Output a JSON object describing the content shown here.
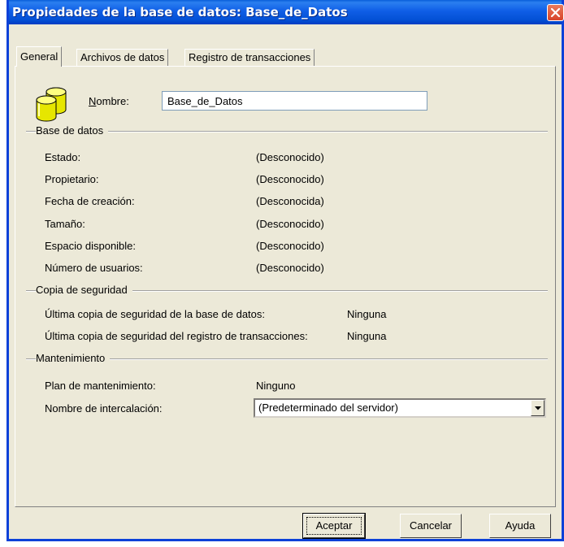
{
  "window": {
    "title": "Propiedades de la base de datos: Base_de_Datos"
  },
  "tabs": [
    {
      "label": "General"
    },
    {
      "label": "Archivos de datos"
    },
    {
      "label": "Registro de transacciones"
    }
  ],
  "name": {
    "label_prefix": "N",
    "label_rest": "ombre:",
    "value": "Base_de_Datos"
  },
  "database": {
    "section_title": "Base de datos",
    "rows": [
      {
        "label": "Estado:",
        "value": "(Desconocido)"
      },
      {
        "label": "Propietario:",
        "value": "(Desconocido)"
      },
      {
        "label": "Fecha de creación:",
        "value": "(Desconocida)"
      },
      {
        "label": "Tamaño:",
        "value": "(Desconocido)"
      },
      {
        "label": "Espacio disponible:",
        "value": "(Desconocido)"
      },
      {
        "label": "Número de usuarios:",
        "value": "(Desconocido)"
      }
    ]
  },
  "backup": {
    "section_title": "Copia de seguridad",
    "rows": [
      {
        "label": "Última copia de seguridad de la base de datos:",
        "value": "Ninguna"
      },
      {
        "label": "Última copia de seguridad del registro de transacciones:",
        "value": "Ninguna"
      }
    ]
  },
  "maintenance": {
    "section_title": "Mantenimiento",
    "plan_label": "Plan de mantenimiento:",
    "plan_value": "Ninguno",
    "collation_label": "Nombre de intercalación:",
    "collation_value": "(Predeterminado del servidor)"
  },
  "buttons": {
    "ok": "Aceptar",
    "cancel": "Cancelar",
    "help": "Ayuda"
  },
  "icons": {
    "close": "close-icon",
    "database": "database-icon",
    "dropdown": "chevron-down-icon"
  }
}
